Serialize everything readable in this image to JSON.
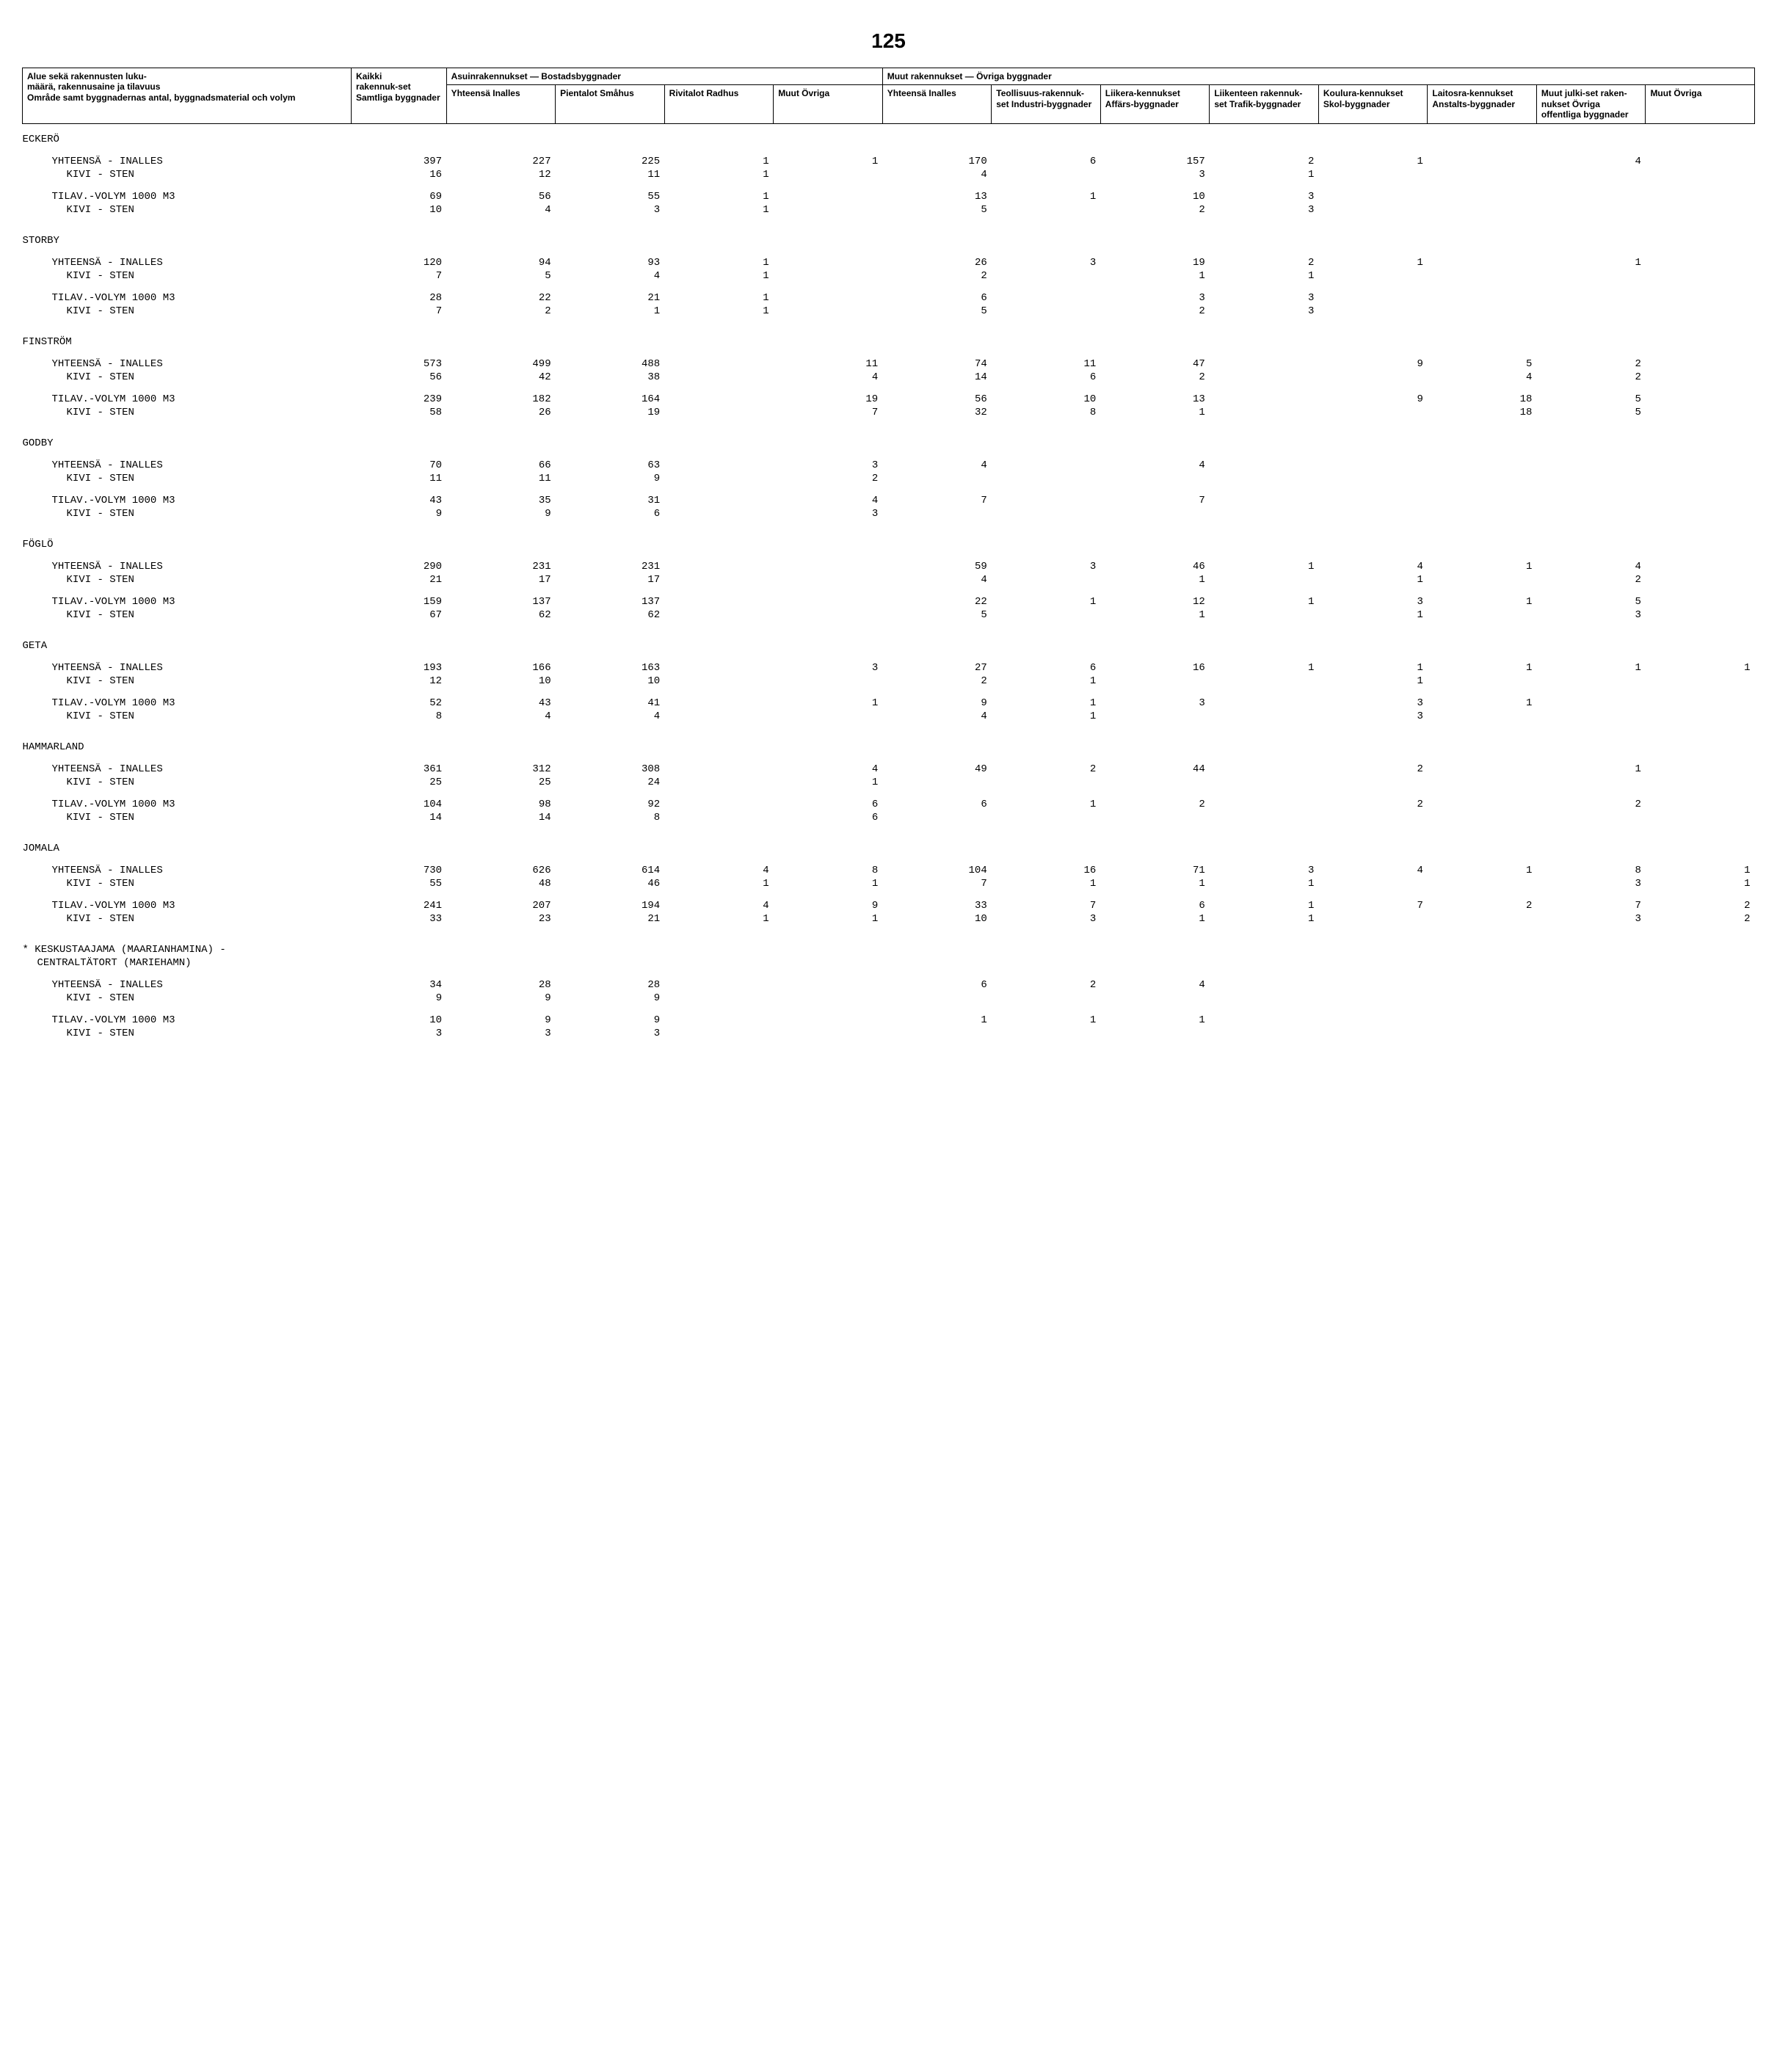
{
  "page_number": "125",
  "headers": {
    "row_label_1": "Alue sekä rakennusten luku-",
    "row_label_2": "määrä, rakennusaine ja tilavuus",
    "row_label_3": "Område samt byggnadernas antal, byggnadsmaterial och volym",
    "kaikki_1": "Kaikki",
    "kaikki_2": "rakennuk-set Samtliga byggnader",
    "asuin_group": "Asuinrakennukset — Bostadsbyggnader",
    "muut_group": "Muut rakennukset — Övriga byggnader",
    "asuin_cols": [
      "Yhteensä Inalles",
      "Pientalot Småhus",
      "Rivitalot Radhus",
      "Muut Övriga"
    ],
    "muut_cols": [
      "Yhteensä Inalles",
      "Teollisuus-rakennuk-set Industri-byggnader",
      "Liikera-kennukset Affärs-byggnader",
      "Liikenteen rakennuk-set Trafik-byggnader",
      "Koulura-kennukset Skol-byggnader",
      "Laitosra-kennukset Anstalts-byggnader",
      "Muut julki-set raken-nukset Övriga offentliga byggnader",
      "Muut Övriga"
    ]
  },
  "rows": [
    {
      "type": "region",
      "label": "ECKERÖ"
    },
    {
      "type": "pair",
      "l1": "YHTEENSÄ - INALLES",
      "l2": "KIVI - STEN",
      "r1": [
        "397",
        "227",
        "225",
        "1",
        "1",
        "170",
        "6",
        "157",
        "2",
        "1",
        "",
        "4",
        ""
      ],
      "r2": [
        "16",
        "12",
        "11",
        "1",
        "",
        "4",
        "",
        "3",
        "1",
        "",
        "",
        "",
        ""
      ]
    },
    {
      "type": "pair",
      "l1": "TILAV.-VOLYM 1000 M3",
      "l2": "KIVI - STEN",
      "r1": [
        "69",
        "56",
        "55",
        "1",
        "",
        "13",
        "1",
        "10",
        "3",
        "",
        "",
        "",
        ""
      ],
      "r2": [
        "10",
        "4",
        "3",
        "1",
        "",
        "5",
        "",
        "2",
        "3",
        "",
        "",
        "",
        ""
      ]
    },
    {
      "type": "region",
      "label": "STORBY"
    },
    {
      "type": "pair",
      "l1": "YHTEENSÄ - INALLES",
      "l2": "KIVI - STEN",
      "r1": [
        "120",
        "94",
        "93",
        "1",
        "",
        "26",
        "3",
        "19",
        "2",
        "1",
        "",
        "1",
        ""
      ],
      "r2": [
        "7",
        "5",
        "4",
        "1",
        "",
        "2",
        "",
        "1",
        "1",
        "",
        "",
        "",
        ""
      ]
    },
    {
      "type": "pair",
      "l1": "TILAV.-VOLYM 1000 M3",
      "l2": "KIVI - STEN",
      "r1": [
        "28",
        "22",
        "21",
        "1",
        "",
        "6",
        "",
        "3",
        "3",
        "",
        "",
        "",
        ""
      ],
      "r2": [
        "7",
        "2",
        "1",
        "1",
        "",
        "5",
        "",
        "2",
        "3",
        "",
        "",
        "",
        ""
      ]
    },
    {
      "type": "region",
      "label": "FINSTRÖM"
    },
    {
      "type": "pair",
      "l1": "YHTEENSÄ - INALLES",
      "l2": "KIVI - STEN",
      "r1": [
        "573",
        "499",
        "488",
        "",
        "11",
        "74",
        "11",
        "47",
        "",
        "9",
        "5",
        "2",
        ""
      ],
      "r2": [
        "56",
        "42",
        "38",
        "",
        "4",
        "14",
        "6",
        "2",
        "",
        "",
        "4",
        "2",
        ""
      ]
    },
    {
      "type": "pair",
      "l1": "TILAV.-VOLYM 1000 M3",
      "l2": "KIVI - STEN",
      "r1": [
        "239",
        "182",
        "164",
        "",
        "19",
        "56",
        "10",
        "13",
        "",
        "9",
        "18",
        "5",
        ""
      ],
      "r2": [
        "58",
        "26",
        "19",
        "",
        "7",
        "32",
        "8",
        "1",
        "",
        "",
        "18",
        "5",
        ""
      ]
    },
    {
      "type": "region",
      "label": "GODBY"
    },
    {
      "type": "pair",
      "l1": "YHTEENSÄ - INALLES",
      "l2": "KIVI - STEN",
      "r1": [
        "70",
        "66",
        "63",
        "",
        "3",
        "4",
        "",
        "4",
        "",
        "",
        "",
        "",
        ""
      ],
      "r2": [
        "11",
        "11",
        "9",
        "",
        "2",
        "",
        "",
        "",
        "",
        "",
        "",
        "",
        ""
      ]
    },
    {
      "type": "pair",
      "l1": "TILAV.-VOLYM 1000 M3",
      "l2": "KIVI - STEN",
      "r1": [
        "43",
        "35",
        "31",
        "",
        "4",
        "7",
        "",
        "7",
        "",
        "",
        "",
        "",
        ""
      ],
      "r2": [
        "9",
        "9",
        "6",
        "",
        "3",
        "",
        "",
        "",
        "",
        "",
        "",
        "",
        ""
      ]
    },
    {
      "type": "region",
      "label": "FÖGLÖ"
    },
    {
      "type": "pair",
      "l1": "YHTEENSÄ - INALLES",
      "l2": "KIVI - STEN",
      "r1": [
        "290",
        "231",
        "231",
        "",
        "",
        "59",
        "3",
        "46",
        "1",
        "4",
        "1",
        "4",
        ""
      ],
      "r2": [
        "21",
        "17",
        "17",
        "",
        "",
        "4",
        "",
        "1",
        "",
        "1",
        "",
        "2",
        ""
      ]
    },
    {
      "type": "pair",
      "l1": "TILAV.-VOLYM 1000 M3",
      "l2": "KIVI - STEN",
      "r1": [
        "159",
        "137",
        "137",
        "",
        "",
        "22",
        "1",
        "12",
        "1",
        "3",
        "1",
        "5",
        ""
      ],
      "r2": [
        "67",
        "62",
        "62",
        "",
        "",
        "5",
        "",
        "1",
        "",
        "1",
        "",
        "3",
        ""
      ]
    },
    {
      "type": "region",
      "label": "GETA"
    },
    {
      "type": "pair",
      "l1": "YHTEENSÄ - INALLES",
      "l2": "KIVI - STEN",
      "r1": [
        "193",
        "166",
        "163",
        "",
        "3",
        "27",
        "6",
        "16",
        "1",
        "1",
        "1",
        "1",
        "1"
      ],
      "r2": [
        "12",
        "10",
        "10",
        "",
        "",
        "2",
        "1",
        "",
        "",
        "1",
        "",
        "",
        ""
      ]
    },
    {
      "type": "pair",
      "l1": "TILAV.-VOLYM 1000 M3",
      "l2": "KIVI - STEN",
      "r1": [
        "52",
        "43",
        "41",
        "",
        "1",
        "9",
        "1",
        "3",
        "",
        "3",
        "1",
        "",
        ""
      ],
      "r2": [
        "8",
        "4",
        "4",
        "",
        "",
        "4",
        "1",
        "",
        "",
        "3",
        "",
        "",
        ""
      ]
    },
    {
      "type": "region",
      "label": "HAMMARLAND"
    },
    {
      "type": "pair",
      "l1": "YHTEENSÄ - INALLES",
      "l2": "KIVI - STEN",
      "r1": [
        "361",
        "312",
        "308",
        "",
        "4",
        "49",
        "2",
        "44",
        "",
        "2",
        "",
        "1",
        ""
      ],
      "r2": [
        "25",
        "25",
        "24",
        "",
        "1",
        "",
        "",
        "",
        "",
        "",
        "",
        "",
        ""
      ]
    },
    {
      "type": "pair",
      "l1": "TILAV.-VOLYM 1000 M3",
      "l2": "KIVI - STEN",
      "r1": [
        "104",
        "98",
        "92",
        "",
        "6",
        "6",
        "1",
        "2",
        "",
        "2",
        "",
        "2",
        ""
      ],
      "r2": [
        "14",
        "14",
        "8",
        "",
        "6",
        "",
        "",
        "",
        "",
        "",
        "",
        "",
        ""
      ]
    },
    {
      "type": "region",
      "label": "JOMALA"
    },
    {
      "type": "pair",
      "l1": "YHTEENSÄ - INALLES",
      "l2": "KIVI - STEN",
      "r1": [
        "730",
        "626",
        "614",
        "4",
        "8",
        "104",
        "16",
        "71",
        "3",
        "4",
        "1",
        "8",
        "1"
      ],
      "r2": [
        "55",
        "48",
        "46",
        "1",
        "1",
        "7",
        "1",
        "1",
        "1",
        "",
        "",
        "3",
        "1"
      ]
    },
    {
      "type": "pair",
      "l1": "TILAV.-VOLYM 1000 M3",
      "l2": "KIVI - STEN",
      "r1": [
        "241",
        "207",
        "194",
        "4",
        "9",
        "33",
        "7",
        "6",
        "1",
        "7",
        "2",
        "7",
        "2"
      ],
      "r2": [
        "33",
        "23",
        "21",
        "1",
        "1",
        "10",
        "3",
        "1",
        "1",
        "",
        "",
        "3",
        "2"
      ]
    },
    {
      "type": "note",
      "label": "* KESKUSTAAJAMA (MAARIANHAMINA) -",
      "label2": "CENTRALTÄTORT (MARIEHAMN)"
    },
    {
      "type": "pair",
      "l1": "YHTEENSÄ - INALLES",
      "l2": "KIVI - STEN",
      "r1": [
        "34",
        "28",
        "28",
        "",
        "",
        "6",
        "2",
        "4",
        "",
        "",
        "",
        "",
        ""
      ],
      "r2": [
        "9",
        "9",
        "9",
        "",
        "",
        "",
        "",
        "",
        "",
        "",
        "",
        "",
        ""
      ]
    },
    {
      "type": "pair",
      "l1": "TILAV.-VOLYM 1000 M3",
      "l2": "KIVI - STEN",
      "r1": [
        "10",
        "9",
        "9",
        "",
        "",
        "1",
        "1",
        "1",
        "",
        "",
        "",
        "",
        ""
      ],
      "r2": [
        "3",
        "3",
        "3",
        "",
        "",
        "",
        "",
        "",
        "",
        "",
        "",
        "",
        ""
      ]
    }
  ]
}
